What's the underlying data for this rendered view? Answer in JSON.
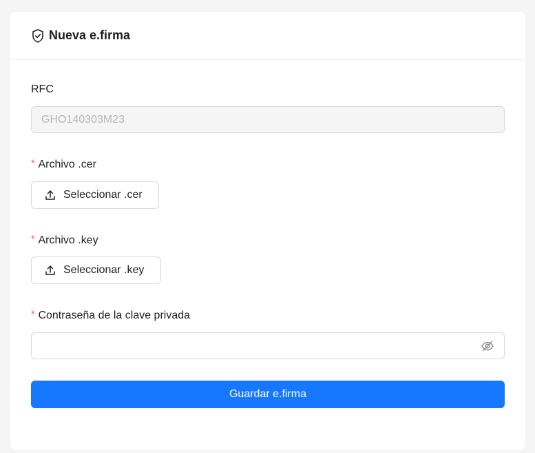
{
  "card": {
    "title": "Nueva e.firma",
    "title_icon": "shield-check-icon"
  },
  "rfc": {
    "label": "RFC",
    "value": "GHO140303M23"
  },
  "cer": {
    "required_mark": "*",
    "label": "Archivo .cer",
    "button_label": "Seleccionar .cer",
    "button_icon": "upload-icon"
  },
  "key": {
    "required_mark": "*",
    "label": "Archivo .key",
    "button_label": "Seleccionar .key",
    "button_icon": "upload-icon"
  },
  "password": {
    "required_mark": "*",
    "label": "Contraseña de la clave privada",
    "value": "",
    "toggle_icon": "eye-invisible-icon"
  },
  "actions": {
    "save_label": "Guardar e.firma"
  },
  "colors": {
    "primary": "#1677ff",
    "required": "#ff4d4f",
    "background": "#f5f5f5"
  }
}
